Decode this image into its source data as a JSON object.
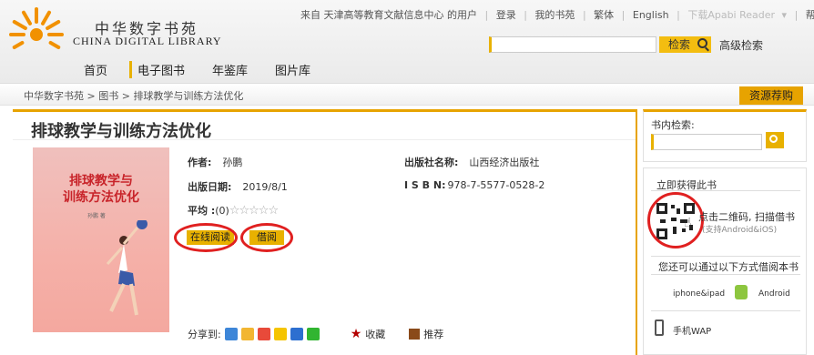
{
  "header": {
    "brand_cn": "中华数字书苑",
    "brand_en": "CHINA DIGITAL LIBRARY",
    "top_links": {
      "from": "来自 天津高等教育文献信息中心 的用户",
      "login": "登录",
      "my_books": "我的书苑",
      "traditional": "繁体",
      "english": "English",
      "download_reader": "下载Apabi Reader",
      "help": "帮助"
    },
    "search_button": "检索",
    "advanced_search": "高级检索"
  },
  "nav": {
    "items": [
      "首页",
      "电子图书",
      "年鉴库",
      "图片库"
    ]
  },
  "breadcrumb": {
    "home": "中华数字书苑",
    "books": "图书",
    "current": "排球教学与训练方法优化",
    "buy_button": "资源荐购"
  },
  "book": {
    "title": "排球教学与训练方法优化",
    "cover_title_1": "排球教学与",
    "cover_title_2": "训练方法优化",
    "cover_author": "孙鹏 著",
    "author_label": "作者:",
    "author": "孙鹏",
    "publisher_label": "出版社名称:",
    "publisher": "山西经济出版社",
    "date_label": "出版日期:",
    "date": "2019/8/1",
    "isbn_label": "I S B N:",
    "isbn": "978-7-5577-0528-2",
    "rating_label": "平均 :",
    "rating_count": "(0)",
    "stars": "☆☆☆☆☆",
    "read_online": "在线阅读",
    "borrow": "借阅"
  },
  "share": {
    "label": "分享到:",
    "favorite": "收藏",
    "recommend": "推荐"
  },
  "sidebar": {
    "inbook_search": "书内检索:",
    "get_book_title": "立即获得此书",
    "qr_text": "点击二维码, 扫描借书",
    "qr_support": "(支持Android&iOS)",
    "other_ways": "您还可以通过以下方式借阅本书",
    "iphone": "iphone&ipad",
    "android": "Android",
    "wap": "手机WAP"
  },
  "colors": {
    "accent": "#e8b100",
    "highlight_circle": "#e02020"
  }
}
